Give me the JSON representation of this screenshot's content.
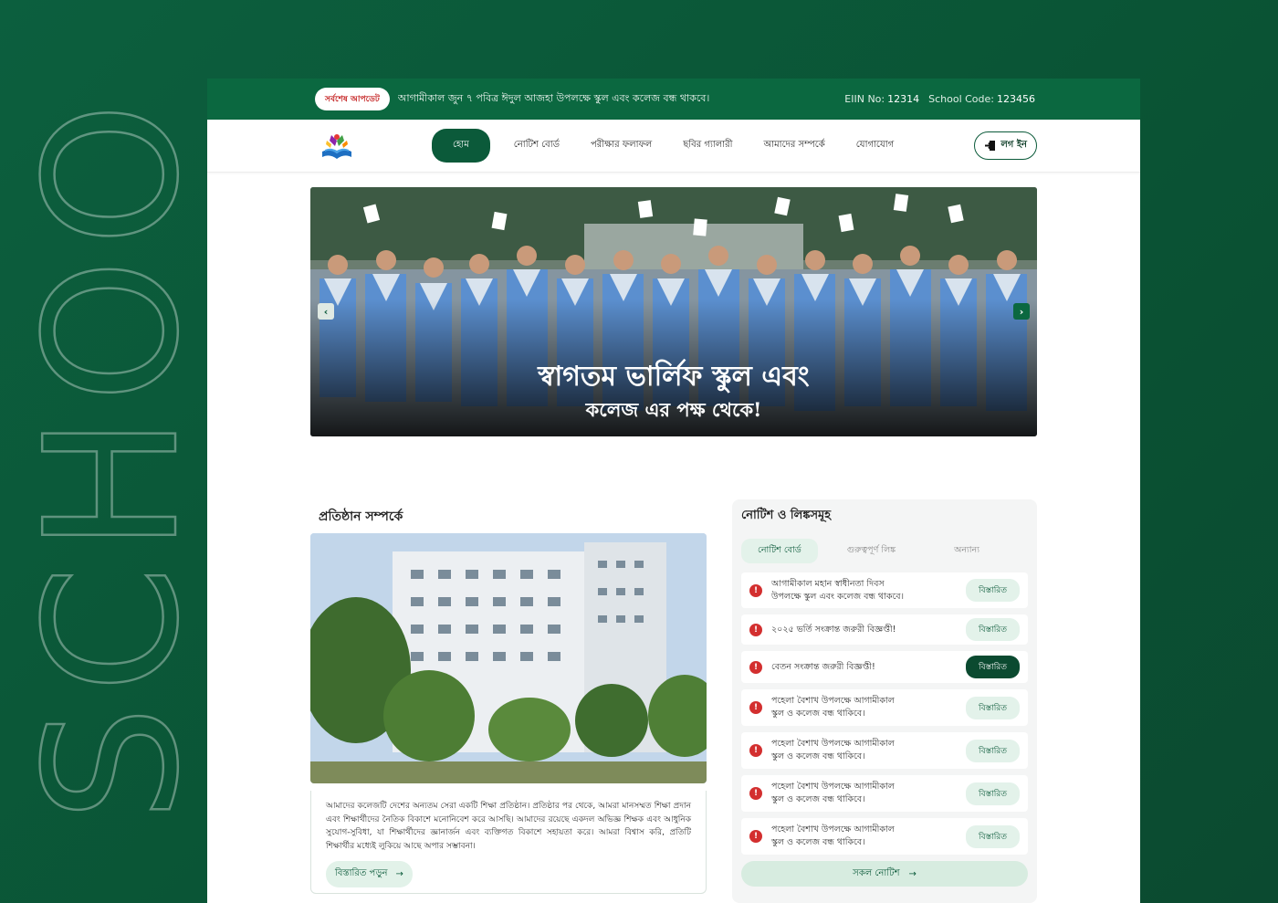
{
  "topbar": {
    "badge": "সর্বশেষ আপডেট",
    "ticker": "আগামীকাল জুন ৭ পবিত্র ঈদুল আজহা উপলক্ষে স্কুল এবং কলেজ বন্ধ থাকবে।",
    "eiin_label": "EIIN No:",
    "eiin_value": "12314",
    "school_code_label": "School Code:",
    "school_code_value": "123456"
  },
  "nav": {
    "items": [
      "হোম",
      "নোটিশ বোর্ড",
      "পরীক্ষার ফলাফল",
      "ছবির গ্যালারী",
      "আমাদের সম্পর্কে",
      "যোগাযোগ"
    ],
    "login": "লগ ইন"
  },
  "hero": {
    "line1": "স্বাগতম ভার্লিফ স্কুল এবং",
    "line2": "কলেজ এর পক্ষ থেকে!",
    "prev_icon": "chevron-left-icon",
    "next_icon": "chevron-right-icon"
  },
  "about": {
    "title": "প্রতিষ্ঠান সম্পর্কে",
    "text": "আমাদের কলেজটি দেশের অন্যতম সেরা একটি শিক্ষা প্রতিষ্ঠান। প্রতিষ্ঠার পর থেকে, আমরা মানসম্মত শিক্ষা প্রদান এবং শিক্ষার্থীদের নৈতিক বিকাশে মনোনিবেশ করে আসছি। আমাদের রয়েছে একদল অভিজ্ঞ শিক্ষক এবং আধুনিক সুযোগ-সুবিধা, যা শিক্ষার্থীদের জ্ঞানার্জন এবং ব্যক্তিগত বিকাশে সহায়তা করে। আমরা বিশ্বাস করি, প্রতিটি শিক্ষার্থীর মধ্যেই লুকিয়ে আছে অপার সম্ভাবনা।",
    "more": "বিস্তারিত পড়ুন"
  },
  "notice": {
    "title": "নোটিশ ও লিঙ্কসমূহ",
    "tabs": [
      "নোটিশ বোর্ড",
      "গুরুত্বপূর্ণ লিঙ্ক",
      "অন্যান্য"
    ],
    "items": [
      {
        "l1": "আগামীকাল মহান স্বাধীনতা দিবস",
        "l2": "উপলক্ষে স্কুল এবং কলেজ বন্ধ থাকবে।",
        "btn": "বিস্তারিত"
      },
      {
        "l1": "২০২৫ ভর্তি সংক্রান্ত জরুরী বিজ্ঞপ্তী!",
        "l2": "",
        "btn": "বিস্তারিত"
      },
      {
        "l1": "বেতন সংক্রান্ত জরুরী বিজ্ঞপ্তী!",
        "l2": "",
        "btn": "বিস্তারিত"
      },
      {
        "l1": "পহেলা বৈশাখ উপলক্ষে আগামীকাল",
        "l2": "স্কুল ও কলেজ বন্ধ থাকিবে।",
        "btn": "বিস্তারিত"
      },
      {
        "l1": "পহেলা বৈশাখ উপলক্ষে আগামীকাল",
        "l2": "স্কুল ও কলেজ বন্ধ থাকিবে।",
        "btn": "বিস্তারিত"
      },
      {
        "l1": "পহেলা বৈশাখ উপলক্ষে আগামীকাল",
        "l2": "স্কুল ও কলেজ বন্ধ থাকিবে।",
        "btn": "বিস্তারিত"
      },
      {
        "l1": "পহেলা বৈশাখ উপলক্ষে আগামীকাল",
        "l2": "স্কুল ও কলেজ বন্ধ থাকিবে।",
        "btn": "বিস্তারিত"
      }
    ],
    "all": "সকল নোটিশ"
  },
  "watermark": "SCHOOL",
  "colors": {
    "brand": "#0b5a3a",
    "accent_light": "#e3f2ea",
    "alert": "#d32f2f"
  }
}
